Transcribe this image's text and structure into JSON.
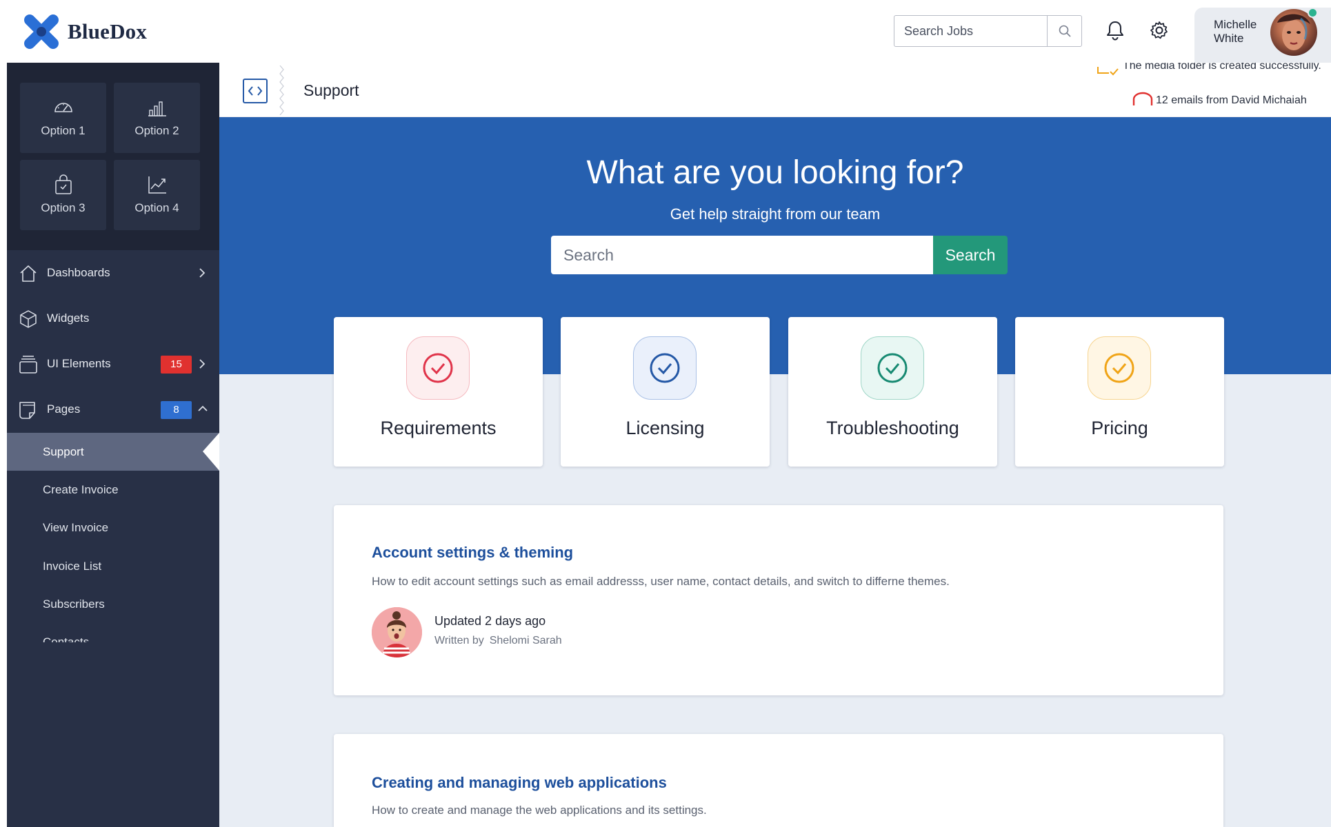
{
  "brand": {
    "name": "BlueDox"
  },
  "header": {
    "search_placeholder": "Search Jobs",
    "user_name": "Michelle White"
  },
  "sidebar": {
    "tiles": [
      {
        "label": "Option 1",
        "icon": "speedometer-icon"
      },
      {
        "label": "Option 2",
        "icon": "bar-chart-icon"
      },
      {
        "label": "Option 3",
        "icon": "shopping-bag-icon"
      },
      {
        "label": "Option 4",
        "icon": "trend-chart-icon"
      }
    ],
    "nav": [
      {
        "label": "Dashboards",
        "icon": "home-icon"
      },
      {
        "label": "Widgets",
        "icon": "cube-icon"
      },
      {
        "label": "UI Elements",
        "icon": "layers-icon",
        "badge": "15",
        "badge_color": "#e0312f"
      },
      {
        "label": "Pages",
        "icon": "pages-icon",
        "badge": "8",
        "badge_color": "#2f6fd0"
      }
    ],
    "sub_items": [
      "Support",
      "Create Invoice",
      "View Invoice",
      "Invoice List",
      "Subscribers",
      "Contacts"
    ]
  },
  "page": {
    "title": "Support",
    "ticker": [
      "The media folder is created successfully.",
      "12 emails from David Michaiah"
    ]
  },
  "hero": {
    "title": "What are you looking for?",
    "subtitle": "Get help straight from our team",
    "search_placeholder": "Search",
    "search_button": "Search"
  },
  "categories": [
    {
      "label": "Requirements",
      "color": "#e0344a",
      "bg": "#fdeeef"
    },
    {
      "label": "Licensing",
      "color": "#2458a6",
      "bg": "#eaf0fb"
    },
    {
      "label": "Troubleshooting",
      "color": "#178a72",
      "bg": "#e8f7f3"
    },
    {
      "label": "Pricing",
      "color": "#f0a417",
      "bg": "#fff6e4"
    }
  ],
  "articles": [
    {
      "title": "Account settings & theming",
      "description": "How to edit account settings such as email addresss, user name, contact details, and switch to differne themes.",
      "updated": "Updated 2 days ago",
      "written_by": "Written by",
      "author": "Shelomi Sarah"
    },
    {
      "title": "Creating and managing web applications",
      "description": "How to create and manage the web applications and its settings."
    }
  ],
  "colors": {
    "primary": "#2660b0",
    "accent": "#23987a",
    "sidebar": "#283046"
  }
}
